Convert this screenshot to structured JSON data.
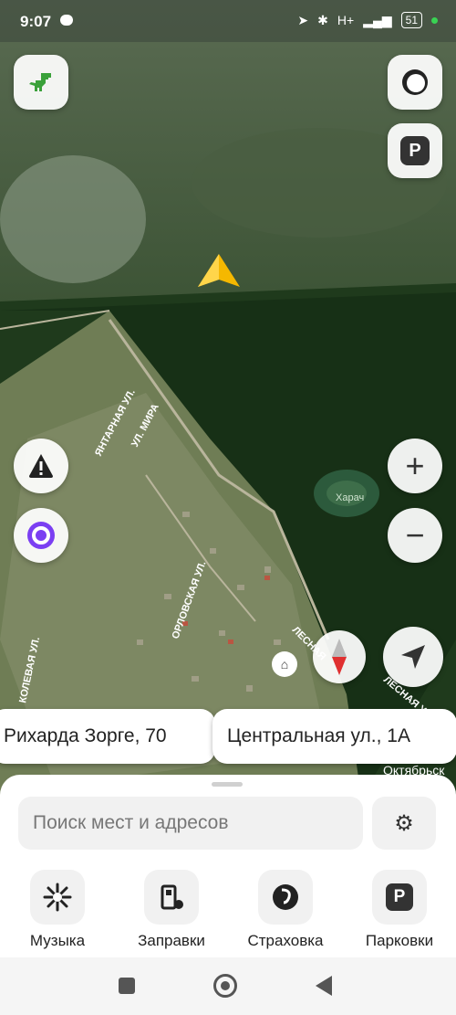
{
  "status_bar": {
    "time": "9:07",
    "network": "H+",
    "battery": "51"
  },
  "map": {
    "street_labels": [
      "ЯНТАРНАЯ УЛ.",
      "УЛ. МИРА",
      "ОРЛОВСКАЯ УЛ.",
      "ЛЕСНАЯ",
      "ЛЕСНАЯ УЛ.",
      "КОЛЕВАЯ УЛ."
    ],
    "lake_label": "Харач",
    "partial_label": "Октябрьск"
  },
  "map_buttons": {
    "parking_letter": "P"
  },
  "address_chips": [
    "Рихарда Зорге, 70",
    "Центральная ул., 1А"
  ],
  "panel": {
    "search_placeholder": "Поиск мест и адресов",
    "categories": [
      {
        "label": "Музыка",
        "icon": "music-burst-icon"
      },
      {
        "label": "Заправки",
        "icon": "fuel-icon"
      },
      {
        "label": "Страховка",
        "icon": "insurance-icon"
      },
      {
        "label": "Парковки",
        "icon": "parking-icon",
        "letter": "P"
      }
    ]
  },
  "colors": {
    "accent_purple": "#7b3ff2",
    "compass_red": "#e03030",
    "arrow_yellow": "#f5b800"
  }
}
